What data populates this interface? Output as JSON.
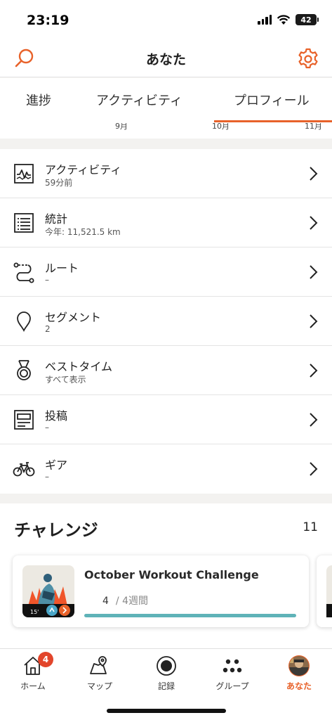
{
  "status": {
    "time": "23:19",
    "battery": "42"
  },
  "header": {
    "title": "あなた",
    "search_icon": "search-icon",
    "settings_icon": "gear-icon"
  },
  "tabs": [
    {
      "label": "進捗"
    },
    {
      "label": "アクティビティ"
    },
    {
      "label": "プロフィール",
      "active": true
    }
  ],
  "months": [
    "9月",
    "10月",
    "11月"
  ],
  "menu": [
    {
      "label": "アクティビティ",
      "sub": "59分前",
      "icon": "activity-chart-icon"
    },
    {
      "label": "統計",
      "sub": "今年: 11,521.5 km",
      "icon": "stats-list-icon"
    },
    {
      "label": "ルート",
      "sub": "–",
      "icon": "route-icon"
    },
    {
      "label": "セグメント",
      "sub": "2",
      "icon": "location-pin-icon"
    },
    {
      "label": "ベストタイム",
      "sub": "すべて表示",
      "icon": "medal-icon"
    },
    {
      "label": "投稿",
      "sub": "–",
      "icon": "post-icon"
    },
    {
      "label": "ギア",
      "sub": "–",
      "icon": "bicycle-icon"
    }
  ],
  "challenges": {
    "title": "チャレンジ",
    "count": "11",
    "card": {
      "name": "October Workout Challenge",
      "progress_value": "4",
      "progress_total": "/ 4週間",
      "progress_fraction": 1.0,
      "badge_label": "15'"
    }
  },
  "bottom_nav": [
    {
      "label": "ホーム",
      "icon": "home-icon",
      "badge": "4"
    },
    {
      "label": "マップ",
      "icon": "map-icon"
    },
    {
      "label": "記録",
      "icon": "record-icon"
    },
    {
      "label": "グループ",
      "icon": "group-icon"
    },
    {
      "label": "あなた",
      "icon": "avatar-icon",
      "active": true
    }
  ],
  "colors": {
    "accent": "#e8622a",
    "progress": "#5fb3b8",
    "badge": "#e2452b"
  }
}
